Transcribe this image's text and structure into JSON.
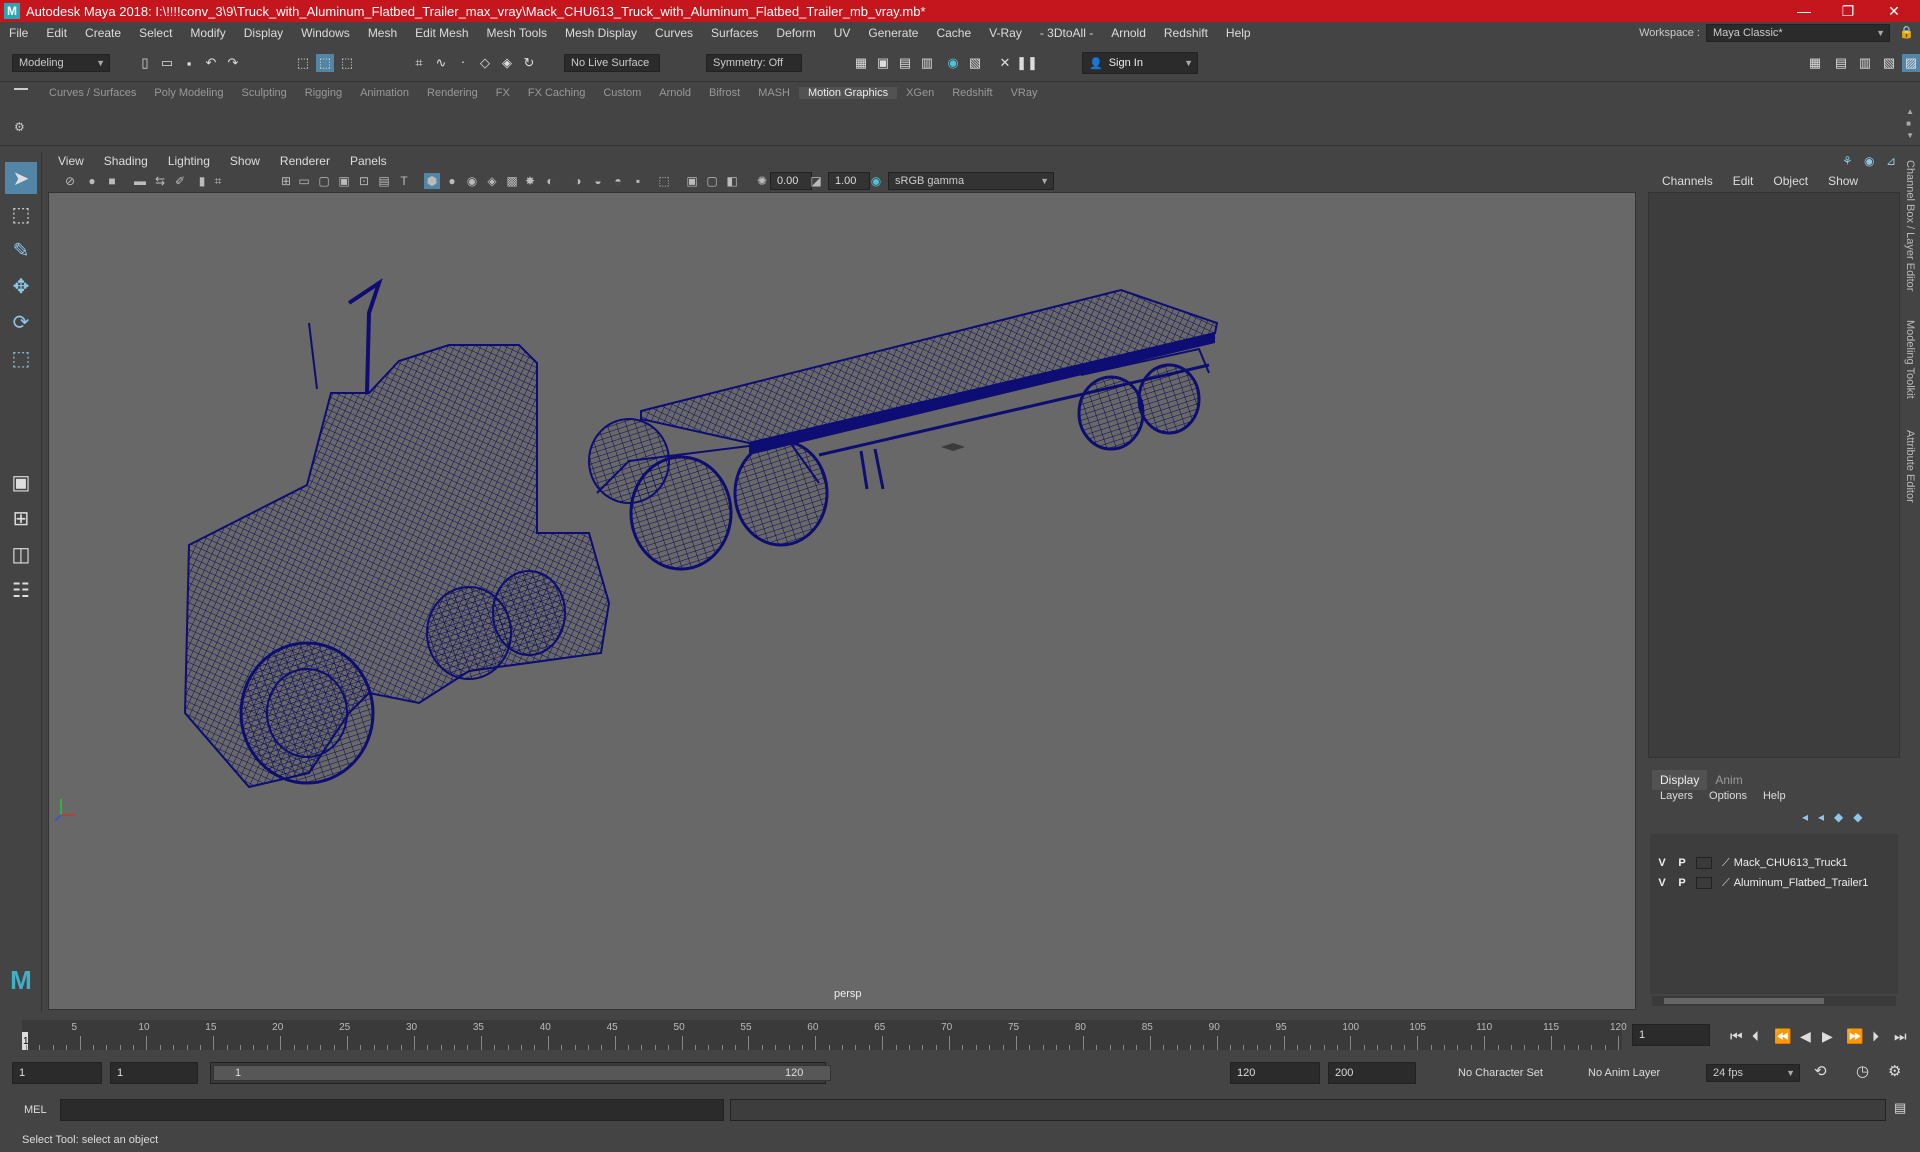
{
  "window": {
    "title": "Autodesk Maya 2018: I:\\!!!!conv_3\\9\\Truck_with_Aluminum_Flatbed_Trailer_max_vray\\Mack_CHU613_Truck_with_Aluminum_Flatbed_Trailer_mb_vray.mb*",
    "minimize": "—",
    "restore": "❐",
    "close": "✕"
  },
  "menubar": {
    "items": [
      "File",
      "Edit",
      "Create",
      "Select",
      "Modify",
      "Display",
      "Windows",
      "Mesh",
      "Edit Mesh",
      "Mesh Tools",
      "Mesh Display",
      "Curves",
      "Surfaces",
      "Deform",
      "UV",
      "Generate",
      "Cache",
      "V-Ray",
      "- 3DtoAll -",
      "Arnold",
      "Redshift",
      "Help"
    ],
    "workspace_label": "Workspace :",
    "workspace_value": "Maya Classic*"
  },
  "statusline": {
    "mode": "Modeling",
    "live_surface": "No Live Surface",
    "symmetry": "Symmetry: Off",
    "sign_in": "Sign In"
  },
  "shelf": {
    "tabs": [
      "Curves / Surfaces",
      "Poly Modeling",
      "Sculpting",
      "Rigging",
      "Animation",
      "Rendering",
      "FX",
      "FX Caching",
      "Custom",
      "Arnold",
      "Bifrost",
      "MASH",
      "Motion Graphics",
      "XGen",
      "Redshift",
      "VRay"
    ],
    "active_tab": "Motion Graphics",
    "svg_label": "svg"
  },
  "viewport": {
    "menus": [
      "View",
      "Shading",
      "Lighting",
      "Show",
      "Renderer",
      "Panels"
    ],
    "exposure": "0.00",
    "gamma": "1.00",
    "color_space": "sRGB gamma",
    "camera_label": "persp",
    "wire_color": "#0d0d73"
  },
  "channel_box": {
    "tabs": [
      "Channels",
      "Edit",
      "Object",
      "Show"
    ],
    "side_tabs": [
      "Channel Box / Layer Editor",
      "Modeling Toolkit",
      "Attribute Editor"
    ]
  },
  "layer_editor": {
    "tabs": [
      "Display",
      "Anim"
    ],
    "active_tab": "Display",
    "menus": [
      "Layers",
      "Options",
      "Help"
    ],
    "layers": [
      {
        "v": "V",
        "p": "P",
        "name": "Mack_CHU613_Truck1"
      },
      {
        "v": "V",
        "p": "P",
        "name": "Aluminum_Flatbed_Trailer1"
      }
    ]
  },
  "timeline": {
    "ticks": [
      "5",
      "10",
      "15",
      "20",
      "25",
      "30",
      "35",
      "40",
      "45",
      "50",
      "55",
      "60",
      "65",
      "70",
      "75",
      "80",
      "85",
      "90",
      "95",
      "100",
      "105",
      "110",
      "115",
      "120"
    ],
    "start_marker": "1",
    "current_frame": "1"
  },
  "range": {
    "start": "1",
    "playback_start": "1",
    "slider_start": "1",
    "slider_end": "120",
    "playback_end": "120",
    "end": "200",
    "character_set": "No Character Set",
    "anim_layer": "No Anim Layer",
    "fps": "24 fps"
  },
  "command_line": {
    "label": "MEL"
  },
  "help_line": {
    "text": "Select Tool: select an object"
  }
}
